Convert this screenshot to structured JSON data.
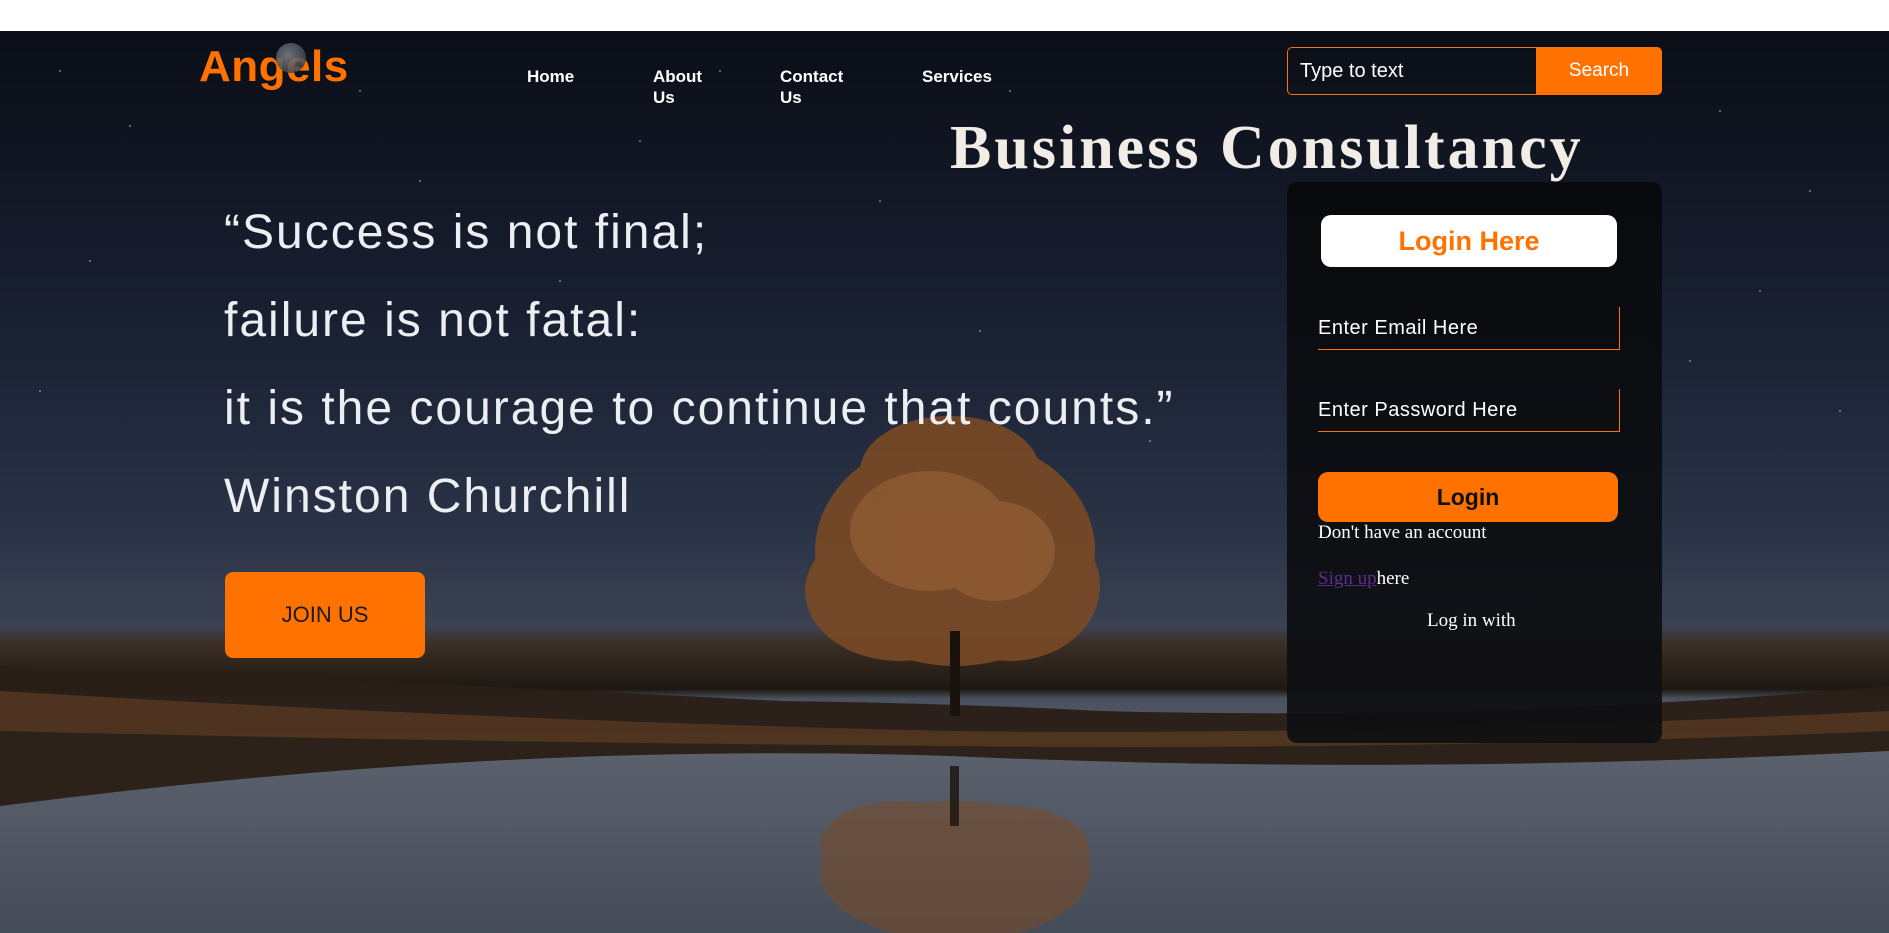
{
  "header": {
    "logo": "Angels",
    "nav": [
      "Home",
      "About\nUs",
      "Contact\nUs",
      "Services"
    ],
    "search": {
      "placeholder": "Type to text",
      "button": "Search"
    }
  },
  "hero": {
    "headline": "Business Consultancy",
    "quote": [
      "“Success is not final;",
      "failure is not fatal:",
      "it is the courage to continue that counts.”",
      "Winston Churchill"
    ],
    "cta": "JOIN US"
  },
  "login": {
    "title": "Login Here",
    "email_placeholder": "Enter Email Here",
    "password_placeholder": "Enter Password Here",
    "button": "Login",
    "no_account": "Don't have an account",
    "signup_link": "Sign up",
    "signup_suffix": "here",
    "login_with": "Log in with"
  },
  "colors": {
    "accent": "#ff7200",
    "link": "#5c2d91",
    "text": "#ffffff"
  }
}
